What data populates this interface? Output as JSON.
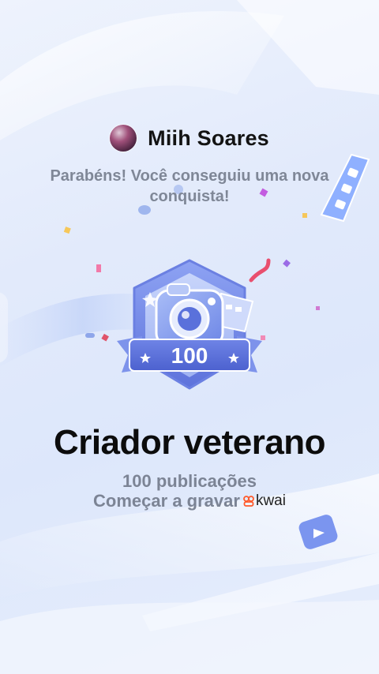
{
  "user": {
    "name": "Miih Soares"
  },
  "message": {
    "congrats": "Parabéns! Você conseguiu uma nova conquista!"
  },
  "achievement": {
    "badge_number": "100",
    "title": "Criador veterano",
    "subtitle": "100 publicações",
    "action_label": "Começar a gravar",
    "brand_label": "kwai",
    "brand_icon": "kwai-logo-icon"
  },
  "colors": {
    "badge_main": "#6f86e8",
    "badge_band": "#5a6fd6",
    "brand_accent": "#ff5a2c"
  }
}
